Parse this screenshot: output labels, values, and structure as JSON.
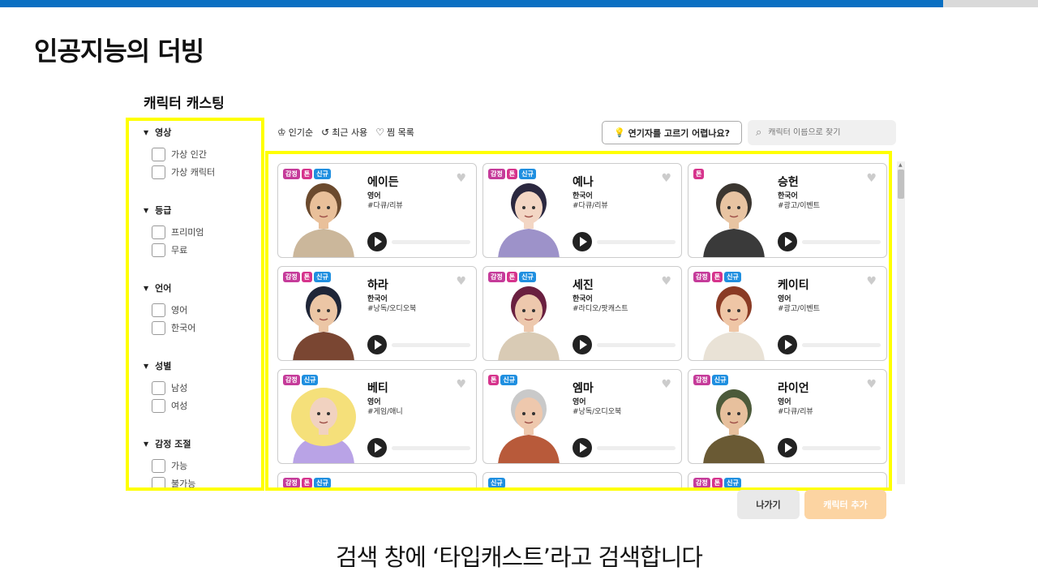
{
  "slide": {
    "title": "인공지능의 더빙",
    "caption": "검색 창에 ‘타입캐스트’라고 검색합니다"
  },
  "casting": {
    "title": "캐릭터 캐스팅"
  },
  "filters": [
    {
      "heading": "영상",
      "options": [
        "가상 인간",
        "가상 캐릭터"
      ]
    },
    {
      "heading": "등급",
      "options": [
        "프리미엄",
        "무료"
      ]
    },
    {
      "heading": "언어",
      "options": [
        "영어",
        "한국어"
      ]
    },
    {
      "heading": "성별",
      "options": [
        "남성",
        "여성"
      ]
    },
    {
      "heading": "감정 조절",
      "options": [
        "가능",
        "불가능"
      ]
    }
  ],
  "toolbar": {
    "popular": "인기순",
    "recent": "최근 사용",
    "favorites": "찜 목록",
    "help_button": "연기자를 고르기 어렵나요?",
    "search_placeholder": "캐릭터 이름으로 찾기"
  },
  "badge_labels": {
    "emotion": "감정",
    "tone": "톤",
    "new": "신규"
  },
  "characters": [
    {
      "name": "에이든",
      "lang": "영어",
      "tag": "#다큐/리뷰",
      "badges": [
        "emotion",
        "tone",
        "new"
      ]
    },
    {
      "name": "예나",
      "lang": "한국어",
      "tag": "#다큐/리뷰",
      "badges": [
        "emotion",
        "tone",
        "new"
      ]
    },
    {
      "name": "승헌",
      "lang": "한국어",
      "tag": "#광고/이벤트",
      "badges": [
        "tone"
      ]
    },
    {
      "name": "하라",
      "lang": "한국어",
      "tag": "#낭독/오디오북",
      "badges": [
        "emotion",
        "tone",
        "new"
      ]
    },
    {
      "name": "세진",
      "lang": "한국어",
      "tag": "#라디오/팟캐스트",
      "badges": [
        "emotion",
        "tone",
        "new"
      ]
    },
    {
      "name": "케이티",
      "lang": "영어",
      "tag": "#광고/이벤트",
      "badges": [
        "emotion",
        "tone",
        "new"
      ]
    },
    {
      "name": "베티",
      "lang": "영어",
      "tag": "#게임/애니",
      "badges": [
        "emotion",
        "new"
      ]
    },
    {
      "name": "엠마",
      "lang": "영어",
      "tag": "#낭독/오디오북",
      "badges": [
        "tone",
        "new"
      ]
    },
    {
      "name": "라이언",
      "lang": "영어",
      "tag": "#다큐/리뷰",
      "badges": [
        "emotion",
        "new"
      ]
    }
  ],
  "partial_row_badges": [
    [
      "emotion",
      "tone",
      "new"
    ],
    [
      "new"
    ],
    [
      "emotion",
      "tone",
      "new"
    ]
  ],
  "buttons": {
    "exit": "나가기",
    "add": "캐릭터 추가"
  },
  "colors": {
    "top_bar": "#0a6fc2",
    "highlight": "#ffff00",
    "badge_emotion": "#c53b9a",
    "badge_tone": "#d6338c",
    "badge_new": "#1f8fe0",
    "add_button": "#fcd4a2"
  }
}
